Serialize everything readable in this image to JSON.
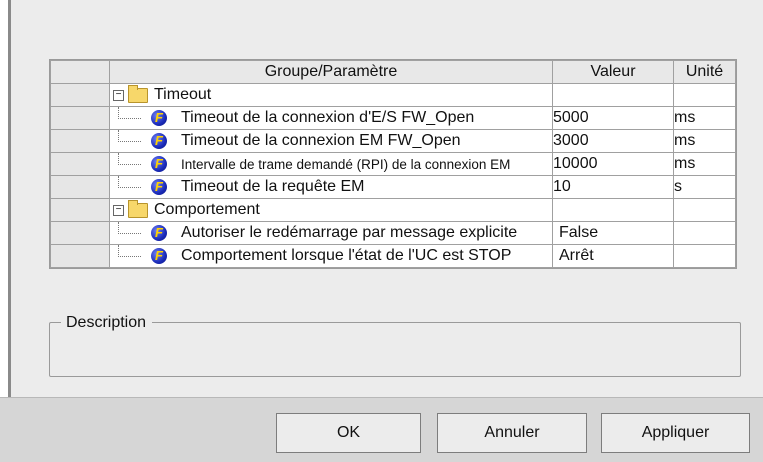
{
  "table": {
    "headers": {
      "name": "Groupe/Paramètre",
      "value": "Valeur",
      "unit": "Unité"
    },
    "groups": [
      {
        "label": "Timeout",
        "params": [
          {
            "name": "Timeout de la connexion d'E/S FW_Open",
            "value": "5000",
            "unit": "ms"
          },
          {
            "name": "Timeout de la connexion EM FW_Open",
            "value": "3000",
            "unit": "ms"
          },
          {
            "name": "Intervalle de trame demandé (RPI) de la connexion EM",
            "value": "10000",
            "unit": "ms"
          },
          {
            "name": "Timeout de la requête EM",
            "value": "10",
            "unit": "s"
          }
        ]
      },
      {
        "label": "Comportement",
        "params": [
          {
            "name": "Autoriser le redémarrage par message explicite",
            "value": "False",
            "unit": ""
          },
          {
            "name": "Comportement lorsque l'état de l'UC est STOP",
            "value": "Arrêt",
            "unit": ""
          }
        ]
      }
    ]
  },
  "description": {
    "label": "Description"
  },
  "buttons": {
    "ok": "OK",
    "cancel": "Annuler",
    "apply": "Appliquer"
  },
  "icons": {
    "group": "folder-icon",
    "param": "parameter-icon",
    "expand": "collapse-toggle-icon"
  }
}
